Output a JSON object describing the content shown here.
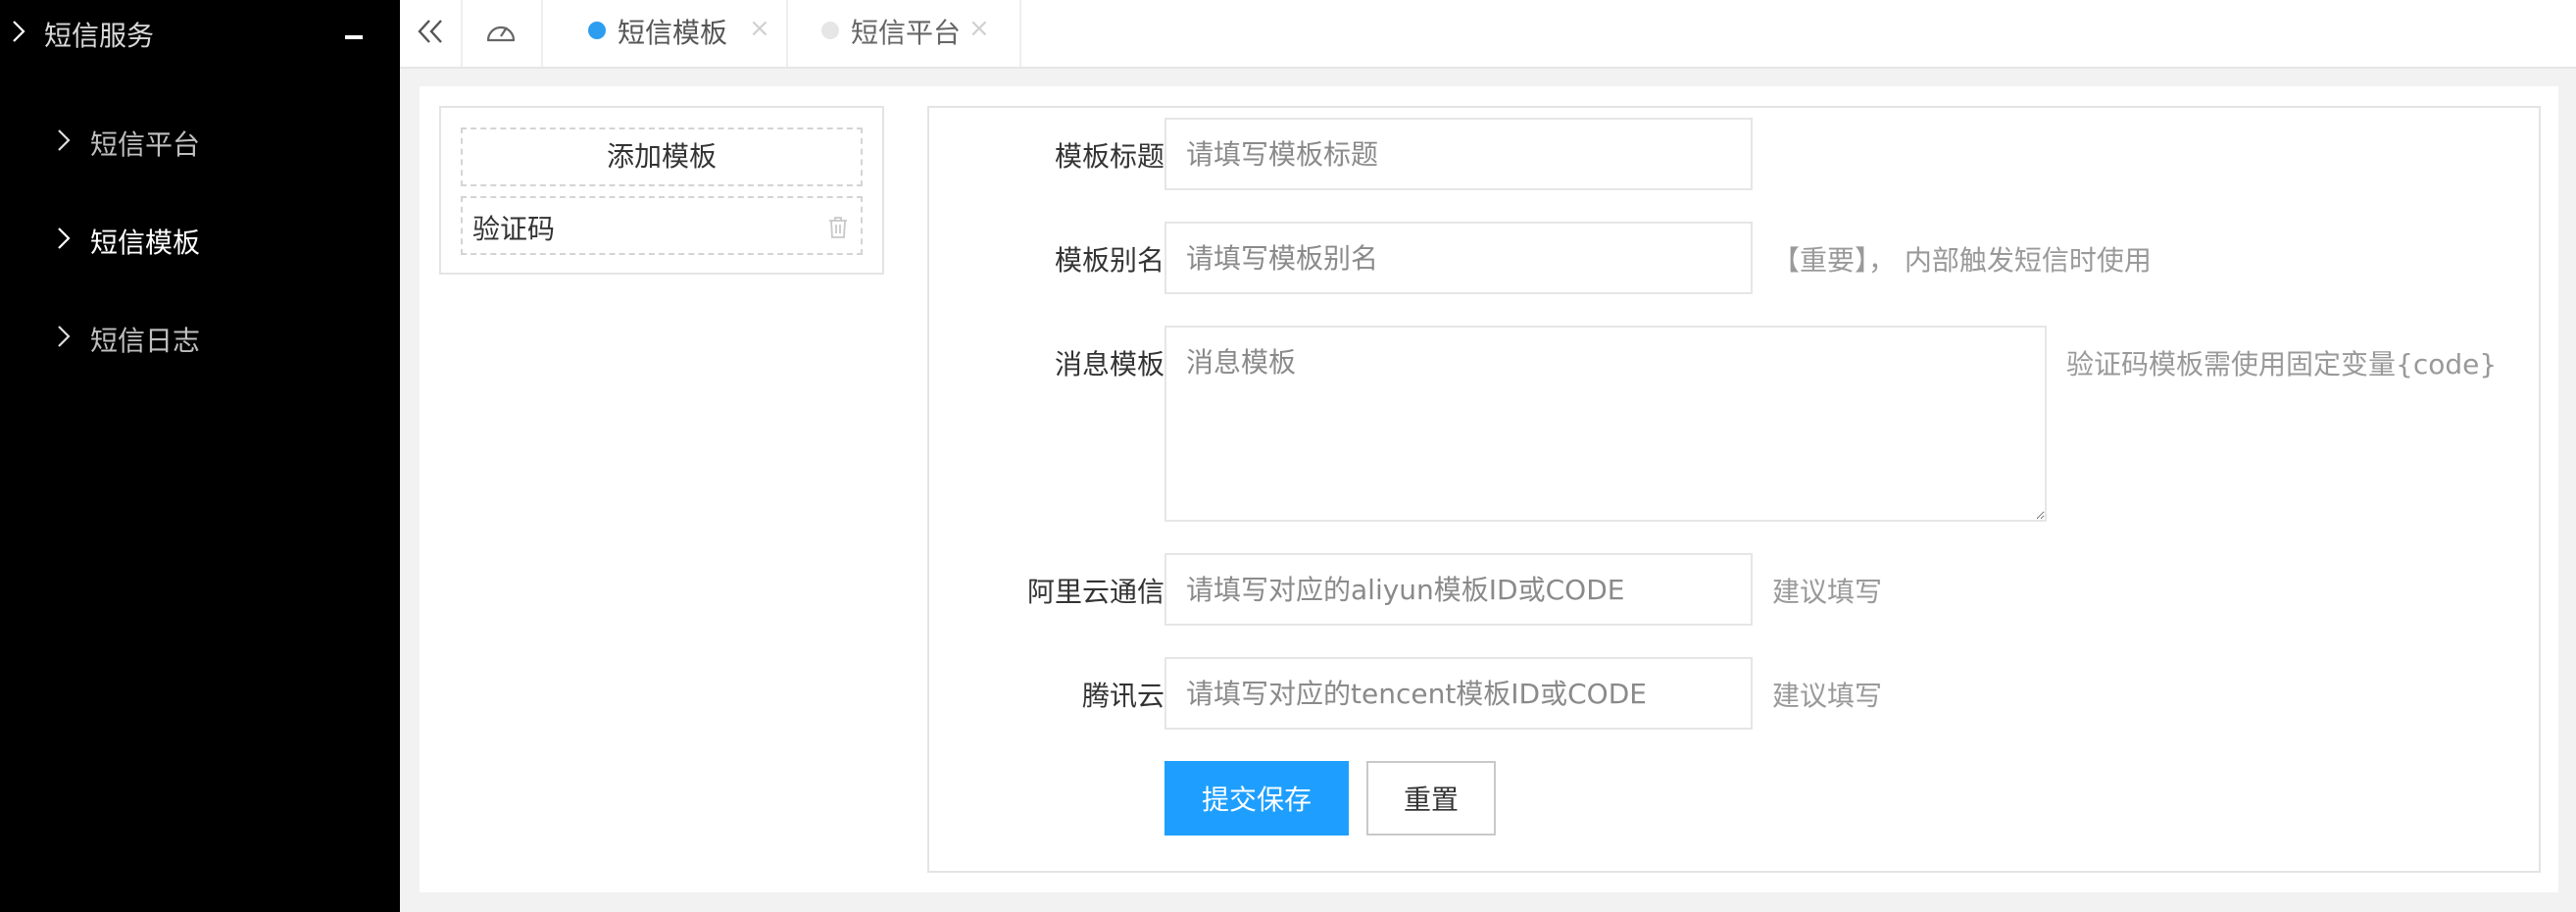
{
  "sidebar": {
    "group": {
      "label": "短信服务",
      "icon": "minus-icon"
    },
    "items": [
      {
        "label": "短信平台",
        "active": false
      },
      {
        "label": "短信模板",
        "active": true
      },
      {
        "label": "短信日志",
        "active": false
      }
    ]
  },
  "topbar": {
    "tabs": [
      {
        "label": "短信模板",
        "active": true,
        "close": "×"
      },
      {
        "label": "短信平台",
        "active": false,
        "close": "×"
      }
    ]
  },
  "templates": {
    "add_label": "添加模板",
    "items": [
      {
        "name": "验证码"
      }
    ]
  },
  "form": {
    "title": {
      "label": "模板标题",
      "placeholder": "请填写模板标题",
      "value": ""
    },
    "alias": {
      "label": "模板别名",
      "placeholder": "请填写模板别名",
      "value": "",
      "hint": "【重要】， 内部触发短信时使用"
    },
    "message": {
      "label": "消息模板",
      "placeholder": "消息模板",
      "value": "",
      "hint": "验证码模板需使用固定变量{code}"
    },
    "aliyun": {
      "label": "阿里云通信",
      "placeholder": "请填写对应的aliyun模板ID或CODE",
      "value": "",
      "hint": "建议填写"
    },
    "tencent": {
      "label": "腾讯云",
      "placeholder": "请填写对应的tencent模板ID或CODE",
      "value": "",
      "hint": "建议填写"
    },
    "submit_label": "提交保存",
    "reset_label": "重置"
  },
  "colors": {
    "sidebar_bg": "#000000",
    "primary": "#1e9fff",
    "active_tab_dot": "#2d9df0",
    "page_bg": "#f2f2f2"
  }
}
